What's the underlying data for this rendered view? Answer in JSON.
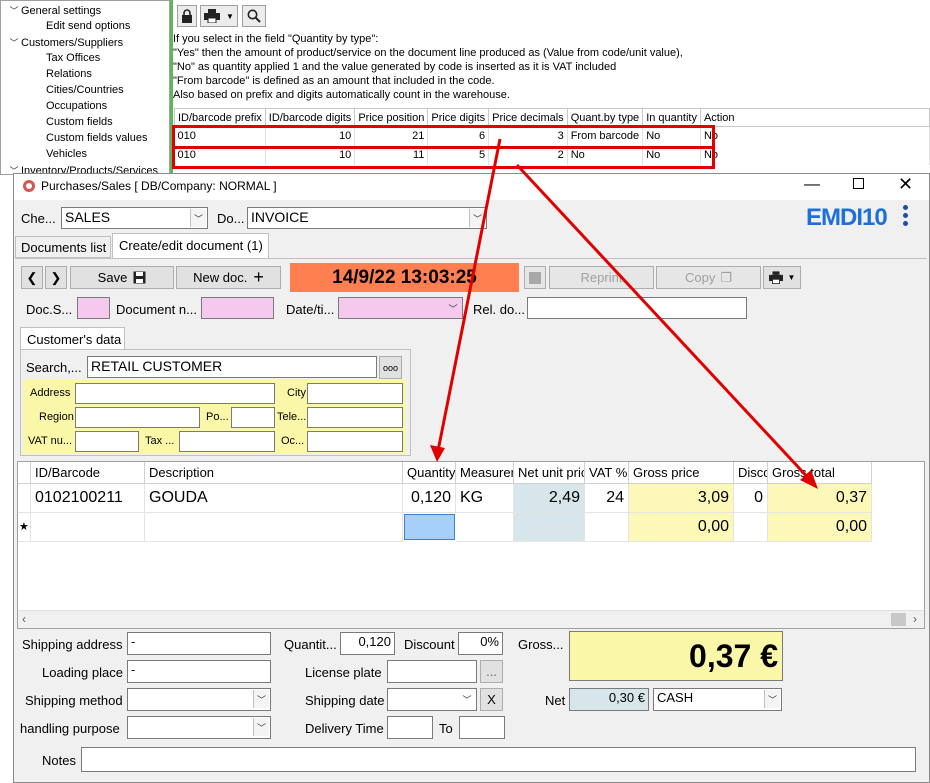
{
  "tree": {
    "items": [
      {
        "label": "General settings",
        "expanded": true,
        "indent": 0
      },
      {
        "label": "Edit send options",
        "indent": 2
      },
      {
        "label": "Customers/Suppliers",
        "expanded": true,
        "indent": 0
      },
      {
        "label": "Tax Offices",
        "indent": 2
      },
      {
        "label": "Relations",
        "indent": 2
      },
      {
        "label": "Cities/Countries",
        "indent": 2
      },
      {
        "label": "Occupations",
        "indent": 2
      },
      {
        "label": "Custom fields",
        "indent": 2
      },
      {
        "label": "Custom fields values",
        "indent": 2
      },
      {
        "label": "Vehicles",
        "indent": 2
      },
      {
        "label": "Inventory/Products/Services",
        "indent": 0
      }
    ]
  },
  "settings_panel": {
    "info_lines": [
      "If you select in the field \"Quantity by type\":",
      " \"Yes\" then the amount of product/service on the document line produced as (Value from code/unit value),",
      "\"No\" as quantity applied 1 and the value generated by code is inserted as it is VAT included",
      "\"From barcode\" is defined as an amount that included in the code.",
      "Also based on prefix and digits automatically count in the warehouse."
    ],
    "columns": [
      "ID/barcode prefix",
      "ID/barcode digits",
      "Price position",
      "Price digits",
      "Price decimals",
      "Quant.by type",
      "In quantity",
      "Action"
    ],
    "rows": [
      [
        "010",
        "10",
        "21",
        "6",
        "3",
        "From barcode",
        "No",
        "No"
      ],
      [
        "010",
        "10",
        "11",
        "5",
        "2",
        "No",
        "No",
        "No"
      ]
    ]
  },
  "window": {
    "title": "Purchases/Sales  [ DB/Company: NORMAL ]",
    "brand": "EMDI10",
    "che_label": "Che...",
    "che_value": "SALES",
    "do_label": "Do...",
    "do_value": "INVOICE",
    "tabs": [
      "Documents list",
      "Create/edit document (1)"
    ],
    "save_label": "Save",
    "new_doc_label": "New doc.",
    "datetime_banner": "14/9/22 13:03:25",
    "reprint_label": "Reprint",
    "copy_label": "Copy",
    "doc_series_label": "Doc.S...",
    "doc_number_label": "Document n...",
    "date_label": "Date/ti...",
    "rel_doc_label": "Rel. do...",
    "customer_tab": "Customer's data",
    "search_label": "Search,...",
    "search_value": "RETAIL CUSTOMER",
    "search_more": "ooo",
    "address_label": "Address",
    "city_label": "City",
    "region_label": "Region",
    "postal_label": "Po...",
    "phone_label": "Tele...",
    "vat_label": "VAT nu...",
    "tax_label": "Tax ...",
    "occupation_label": "Oc..."
  },
  "grid": {
    "columns": [
      "ID/Barcode",
      "Description",
      "Quantity",
      "Measurem",
      "Net unit pric",
      "VAT %",
      "Gross price",
      "Disco",
      "Gross total"
    ],
    "rows": [
      {
        "id": "0102100211",
        "description": "GOUDA",
        "quantity": "0,120",
        "measure": "KG",
        "net_unit": "2,49",
        "vat": "24",
        "gross_price": "3,09",
        "discount": "0",
        "gross_total": "0,37"
      },
      {
        "id": "",
        "description": "",
        "quantity": "",
        "measure": "",
        "net_unit": "",
        "vat": "",
        "gross_price": "0,00",
        "discount": "",
        "gross_total": "0,00"
      }
    ],
    "new_row_marker": "★"
  },
  "bottom": {
    "shipping_address_label": "Shipping address",
    "shipping_address_value": "-",
    "loading_place_label": "Loading place",
    "loading_place_value": "-",
    "shipping_method_label": "Shipping method",
    "handling_purpose_label": "handling purpose",
    "quantity_label": "Quantit...",
    "quantity_value": "0,120",
    "discount_label": "Discount",
    "discount_value": "0%",
    "license_plate_label": "License plate",
    "license_more": "...",
    "shipping_date_label": "Shipping date",
    "clear_label": "X",
    "delivery_time_label": "Delivery Time",
    "to_label": "To",
    "gross_label": "Gross...",
    "gross_total": "0,37 €",
    "net_label": "Net",
    "net_value": "0,30 €",
    "payment_value": "CASH",
    "notes_label": "Notes"
  },
  "colors": {
    "banner": "#ff7f50",
    "highlight_red": "#e00000",
    "pink_field": "#f5c8ee",
    "yellow": "#fbf7a9",
    "brand_blue": "#1e6fd9"
  }
}
